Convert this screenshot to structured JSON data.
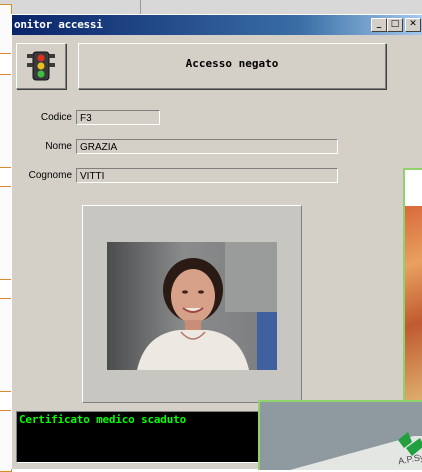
{
  "window": {
    "title": "onitor accessi",
    "controls": {
      "minimize": "_",
      "maximize": "□",
      "close": "✕"
    }
  },
  "status": {
    "icon": "traffic-light-icon",
    "message": "Accesso negato"
  },
  "fields": {
    "codice": {
      "label": "Codice",
      "value": "F3"
    },
    "nome": {
      "label": "Nome",
      "value": "GRAZIA"
    },
    "cognome": {
      "label": "Cognome",
      "value": "VITTI"
    }
  },
  "photo": {
    "icon": "person-photo"
  },
  "certificate": {
    "message": "Certificato medico scaduto"
  },
  "card": {
    "brand": "A.P.Sy"
  },
  "colors": {
    "title_bar": "#0a246a",
    "dialog_bg": "#d4d0c8",
    "cert_text": "#00ff00",
    "cert_bg": "#000000",
    "background_box_border": "#d98a2a",
    "side_image_border": "#8fd16a"
  }
}
